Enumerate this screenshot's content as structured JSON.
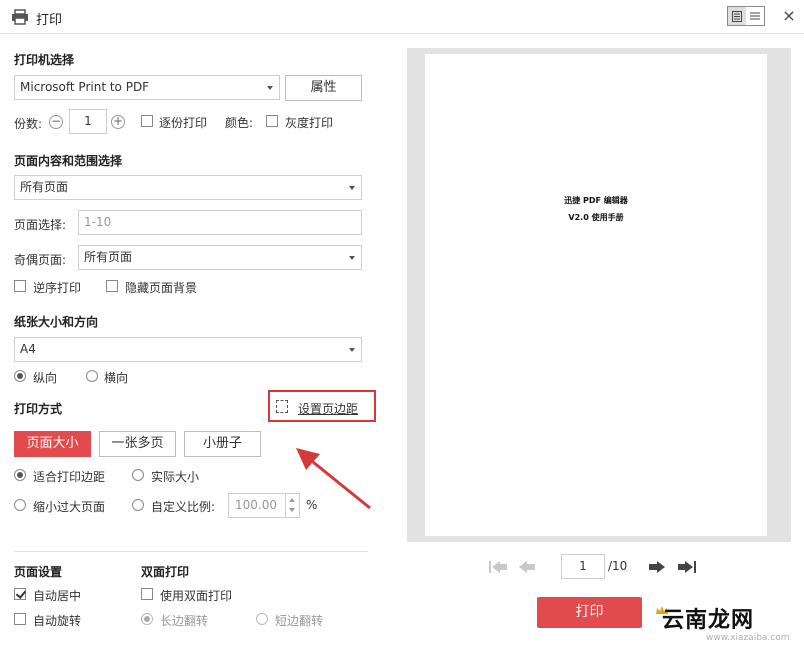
{
  "window": {
    "title": "打印",
    "close_symbol": "×"
  },
  "printer": {
    "section_title": "打印机选择",
    "selected": "Microsoft Print to PDF",
    "properties_label": "属性",
    "copies_label": "份数:",
    "copies_value": "1",
    "minus": "−",
    "plus": "+",
    "collate_label": "逐份打印",
    "collate_checked": false,
    "color_label": "颜色:",
    "grayscale_label": "灰度打印",
    "grayscale_checked": false
  },
  "range": {
    "section_title": "页面内容和范围选择",
    "content_selected": "所有页面",
    "page_select_label": "页面选择:",
    "page_select_placeholder": "1-10",
    "odd_even_label": "奇偶页面:",
    "odd_even_selected": "所有页面",
    "reverse_label": "逆序打印",
    "reverse_checked": false,
    "hide_bg_label": "隐藏页面背景",
    "hide_bg_checked": false
  },
  "paper": {
    "section_title": "纸张大小和方向",
    "size_selected": "A4",
    "portrait_label": "纵向",
    "portrait_checked": true,
    "landscape_label": "横向",
    "landscape_checked": false
  },
  "print_mode": {
    "section_title": "打印方式",
    "margin_link": "设置页边距",
    "tabs": [
      {
        "label": "页面大小",
        "active": true
      },
      {
        "label": "一张多页",
        "active": false
      },
      {
        "label": "小册子",
        "active": false
      }
    ],
    "fit_label": "适合打印边距",
    "fit_checked": true,
    "actual_label": "实际大小",
    "actual_checked": false,
    "shrink_label": "缩小过大页面",
    "shrink_checked": false,
    "custom_label": "自定义比例:",
    "custom_checked": false,
    "custom_value": "100.00",
    "percent": "%"
  },
  "page_settings": {
    "section_title": "页面设置",
    "auto_center_label": "自动居中",
    "auto_center_checked": true,
    "auto_rotate_label": "自动旋转",
    "auto_rotate_checked": false
  },
  "duplex": {
    "section_title": "双面打印",
    "use_duplex_label": "使用双面打印",
    "use_duplex_checked": false,
    "long_edge_label": "长边翻转",
    "long_edge_checked": true,
    "short_edge_label": "短边翻转",
    "short_edge_checked": false
  },
  "preview": {
    "line1": "迅捷 PDF 编辑器",
    "line2": "V2.0 使用手册"
  },
  "pager": {
    "current_page": "1",
    "total": "/10"
  },
  "actions": {
    "print_label": "打印"
  },
  "watermark": {
    "text": "云南龙网",
    "url": "www.xiazaiba.com"
  },
  "colors": {
    "accent": "#e24b4d",
    "highlight": "#d43a3a"
  }
}
